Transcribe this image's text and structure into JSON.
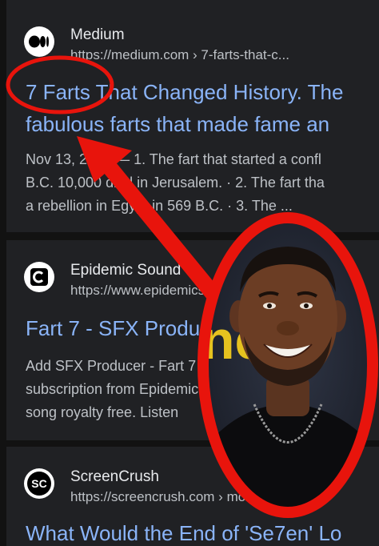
{
  "results": [
    {
      "site_name": "Medium",
      "url": "https://medium.com › 7-farts-that-c...",
      "title_lines": [
        "7 Farts That Changed History. The",
        "fabulous farts that made fame an"
      ],
      "snippet_lines": [
        "Nov 13, 2020 — 1. The fart that started a confl",
        "B.C. 10,000 died in Jerusalem. · 2. The fart tha",
        "a rebellion in Egypt in 569 B.C. · 3. The ..."
      ],
      "icon": "medium-logo-icon"
    },
    {
      "site_name": "Epidemic Sound",
      "url": "https://www.epidemicsound.com",
      "title_lines": [
        "Fart 7 - SFX Producer"
      ],
      "snippet_lines": [
        "Add SFX Producer - Fart 7",
        "subscription from Epidemic Sound",
        "song royalty free. Listen"
      ],
      "icon": "epidemic-sound-logo-icon"
    },
    {
      "site_name": "ScreenCrush",
      "url": "https://screencrush.com › movies-wi...",
      "title_lines": [
        "What Would the End of 'Se7en' Lo"
      ],
      "snippet_lines": [],
      "icon": "screencrush-logo-icon"
    }
  ],
  "overlay": {
    "photo_text": "ne",
    "colors": {
      "annotation_red": "#e8140c",
      "link_blue": "#8ab4f8",
      "card_bg": "#202124",
      "page_bg": "#121212"
    }
  }
}
